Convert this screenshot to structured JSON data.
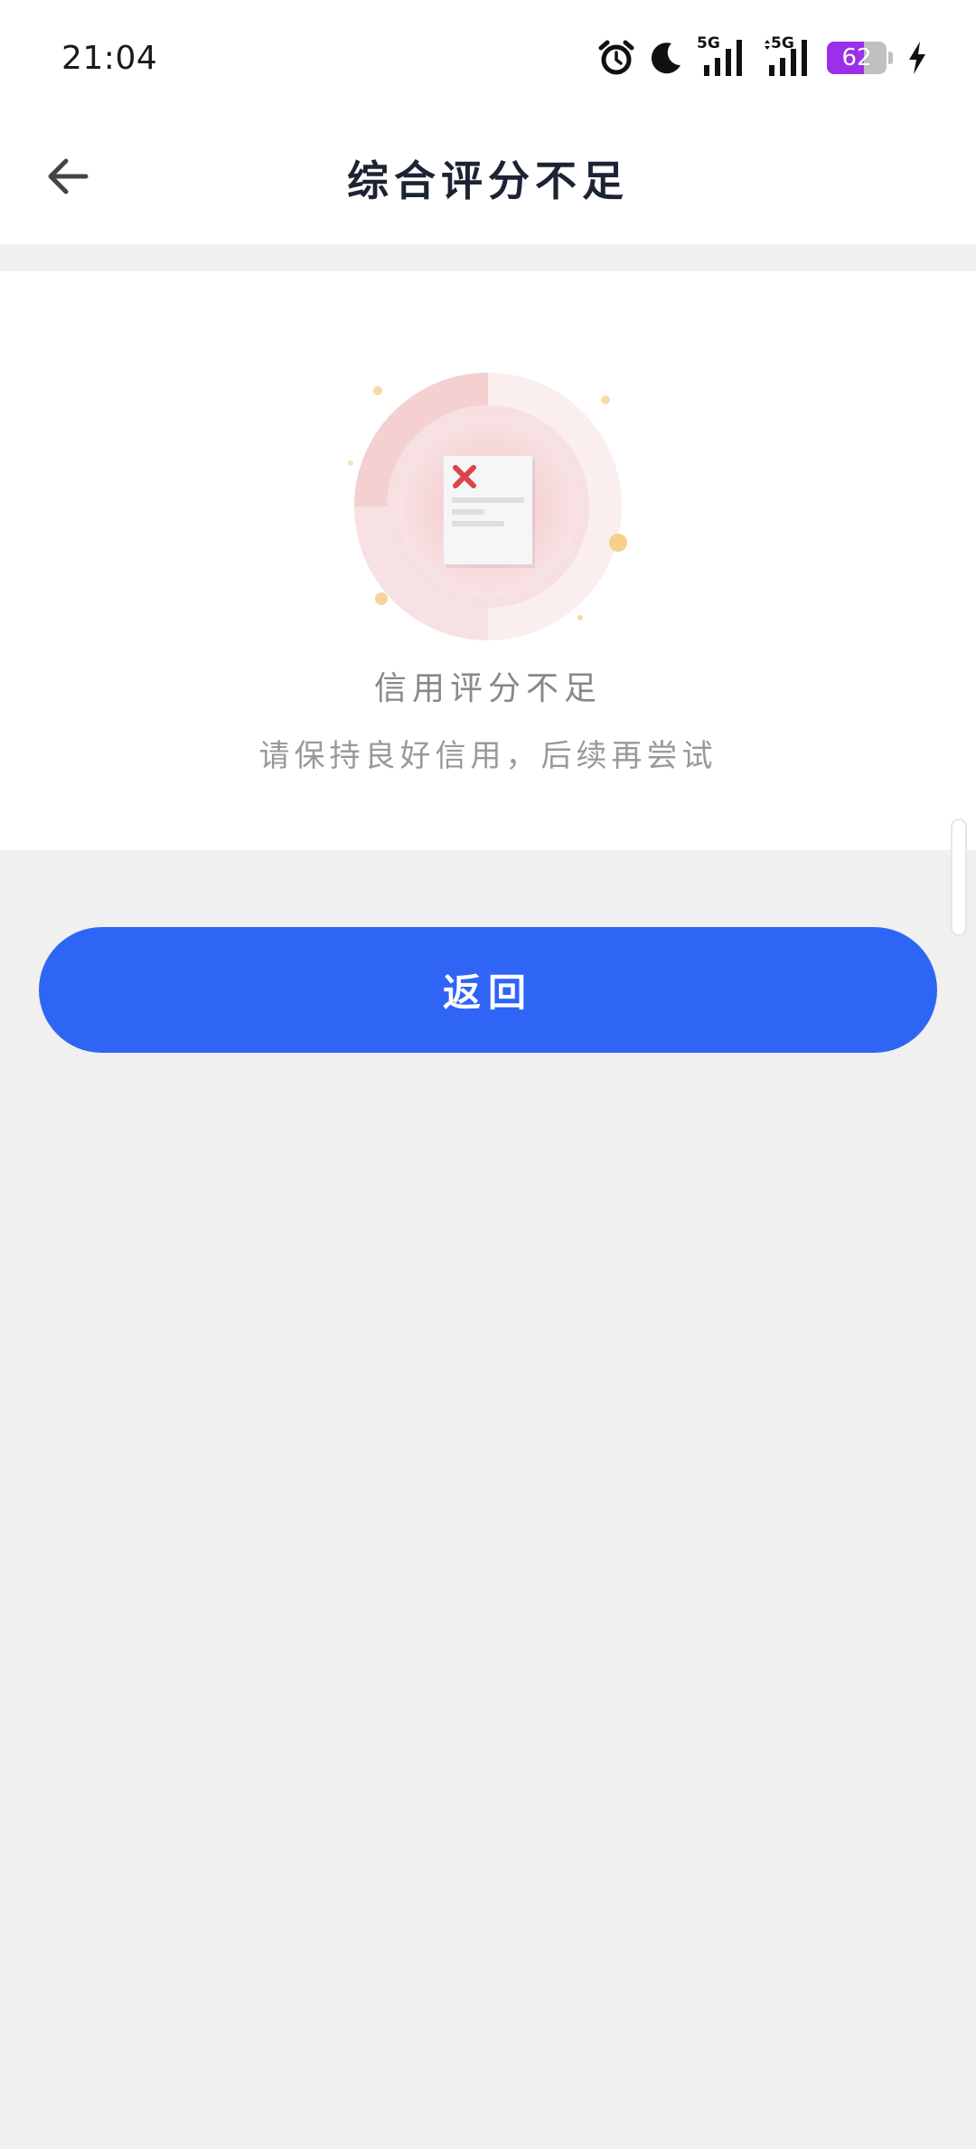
{
  "status_bar": {
    "time": "21:04",
    "icons": [
      "alarm-icon",
      "moon-icon",
      "signal-5g-icon",
      "signal-5g-icon",
      "battery-icon",
      "charging-icon"
    ],
    "signal_labels": [
      "5G",
      "5G"
    ],
    "battery_percent": "62",
    "battery_color": "#9b30e8"
  },
  "nav": {
    "title": "综合评分不足",
    "back_icon": "arrow-left-icon"
  },
  "content": {
    "illustration_icon": "rejected-document-icon",
    "title": "信用评分不足",
    "subtitle": "请保持良好信用，后续再尝试"
  },
  "actions": {
    "return_label": "返回",
    "accent_color": "#2f65f5"
  }
}
